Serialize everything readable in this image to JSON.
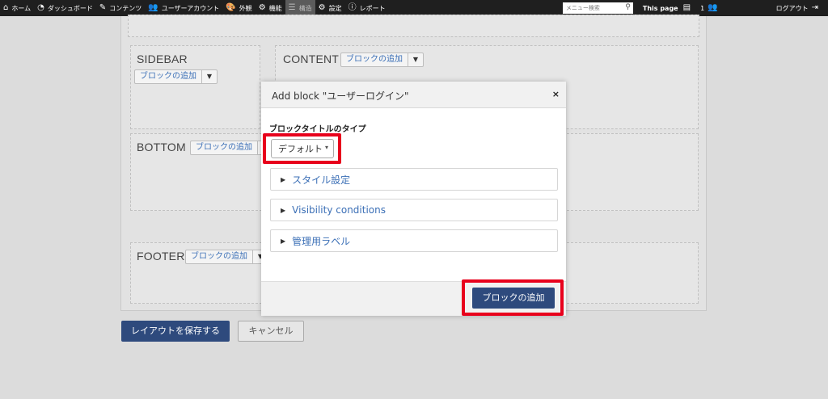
{
  "adminbar": {
    "items": [
      {
        "icon": "home-icon",
        "glyph": "⌂",
        "label": "ホーム"
      },
      {
        "icon": "dashboard-icon",
        "glyph": "◔",
        "label": "ダッシュボード"
      },
      {
        "icon": "pencil-icon",
        "glyph": "✎",
        "label": "コンテンツ"
      },
      {
        "icon": "users-icon",
        "glyph": "👥",
        "label": "ユーザーアカウント"
      },
      {
        "icon": "palette-icon",
        "glyph": "🎨",
        "label": "外観"
      },
      {
        "icon": "puzzle-icon",
        "glyph": "⚙",
        "label": "機能"
      },
      {
        "icon": "layers-icon",
        "glyph": "☰",
        "label": "構造"
      },
      {
        "icon": "gear-icon",
        "glyph": "⚙",
        "label": "設定"
      },
      {
        "icon": "info-icon",
        "glyph": "ⓘ",
        "label": "レポート"
      }
    ],
    "search_placeholder": "メニュー検索",
    "this_page": "This page",
    "user_count": "1",
    "logout": "ログアウト"
  },
  "regions": {
    "sidebar": {
      "title": "SIDEBAR",
      "add_label": "ブロックの追加"
    },
    "content": {
      "title": "CONTENT",
      "add_label": "ブロックの追加"
    },
    "bottom": {
      "title": "BOTTOM",
      "add_label": "ブロックの追加"
    },
    "footer": {
      "title": "FOOTER",
      "add_label": "ブロックの追加"
    }
  },
  "actions": {
    "save_layout": "レイアウトを保存する",
    "cancel": "キャンセル"
  },
  "modal": {
    "title": "Add block \"ユーザーログイン\"",
    "close": "×",
    "field_label": "ブロックタイトルのタイプ",
    "select_value": "デフォルト",
    "sections": [
      {
        "label": "スタイル設定"
      },
      {
        "label": "Visibility conditions"
      },
      {
        "label": "管理用ラベル"
      }
    ],
    "submit": "ブロックの追加"
  },
  "colors": {
    "highlight": "#e8001c",
    "primary_button": "#2e4a7d",
    "link": "#3b6fb6"
  }
}
